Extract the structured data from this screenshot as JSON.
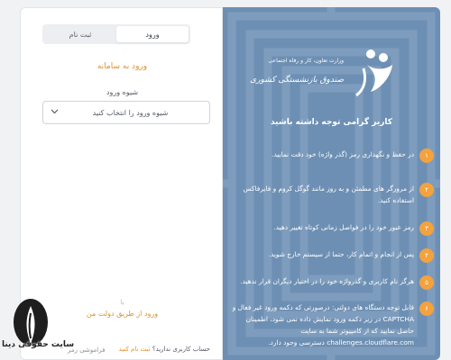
{
  "tabs": [
    {
      "label": "ورود",
      "active": true
    },
    {
      "label": "ثبت نام",
      "active": false
    }
  ],
  "login": {
    "title": "ورود به سامانه",
    "method_label": "شیوه ورود",
    "method_select": {
      "value": "شیوه ورود را انتخاب کنید",
      "icon": "chevron-down-icon"
    },
    "separator": "یا",
    "gov_link": "ورود از طریق دولت من",
    "no_account_text": "حساب کاربری ندارید؟",
    "register_link": "ثبت نام کنید",
    "extra_text": "فراموشی رمز"
  },
  "watermark": {
    "text": "سایت حقوقی دینا"
  },
  "panel": {
    "logo": {
      "ministry": "وزارت تعاون، کار و رفاه اجتماعی",
      "fund": "صندوق بازنشستگی کشوری"
    },
    "title": "کاربر گرامی توجه داشته باشید",
    "items": [
      {
        "num": "۱",
        "text": "در حفظ و نگهداری رمز (گذر واژه) خود دقت نمایید."
      },
      {
        "num": "۲",
        "text": "از مرورگر های مطمئن و به روز مانند گوگل کروم و فایرفاکس استفاده کنید."
      },
      {
        "num": "۳",
        "text": "رمز عبور خود را در فواصل زمانی کوتاه تغییر دهید."
      },
      {
        "num": "۴",
        "text": "پس از انجام و اتمام کار، حتما از سیستم خارج شوید."
      },
      {
        "num": "۵",
        "text": "هرگز نام کاربری و گذرواژه خود را در اختیار دیگران قرار ندهید."
      },
      {
        "num": "۶",
        "text": "قابل توجه دستگاه های دولتی: درصورتی که دکمه ورود غیر فعال و CAPTCHA در زیر دکمه ورود نمایش داده نمی شود، اطمینان حاصل نمایید که از کامپیوتر شما به سایت challenges.cloudflare.com دسترسی وجود دارد."
      }
    ]
  },
  "colors": {
    "accent": "#e0912a",
    "panel_bg": "#6d8fb3",
    "badge": "#f3a23e"
  }
}
